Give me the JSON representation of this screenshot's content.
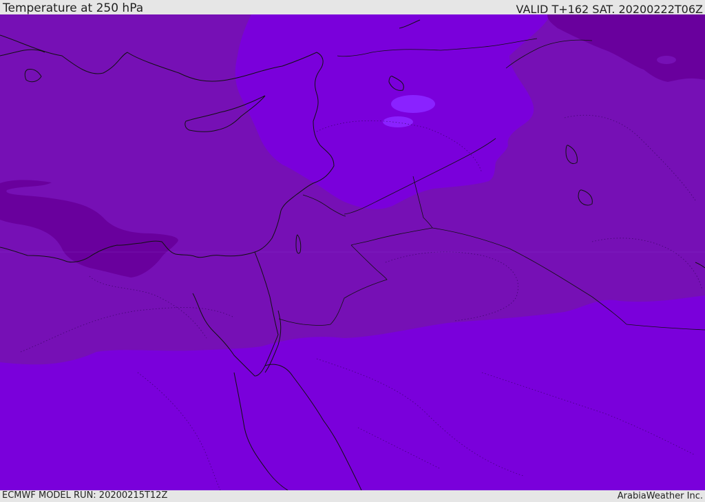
{
  "header": {
    "title": "Temperature at 250 hPa",
    "valid": "VALID T+162 SAT. 20200222T06Z"
  },
  "footer": {
    "model_run": "ECMWF MODEL RUN: 20200215T12Z",
    "credit": "ArabiaWeather Inc."
  },
  "colors": {
    "band_warm": "#7a00db",
    "band_mid": "#7610b5",
    "band_cold": "#69009d",
    "band_light": "#7b00ea",
    "pocket": "#8a22ff",
    "coast": "#111111"
  }
}
